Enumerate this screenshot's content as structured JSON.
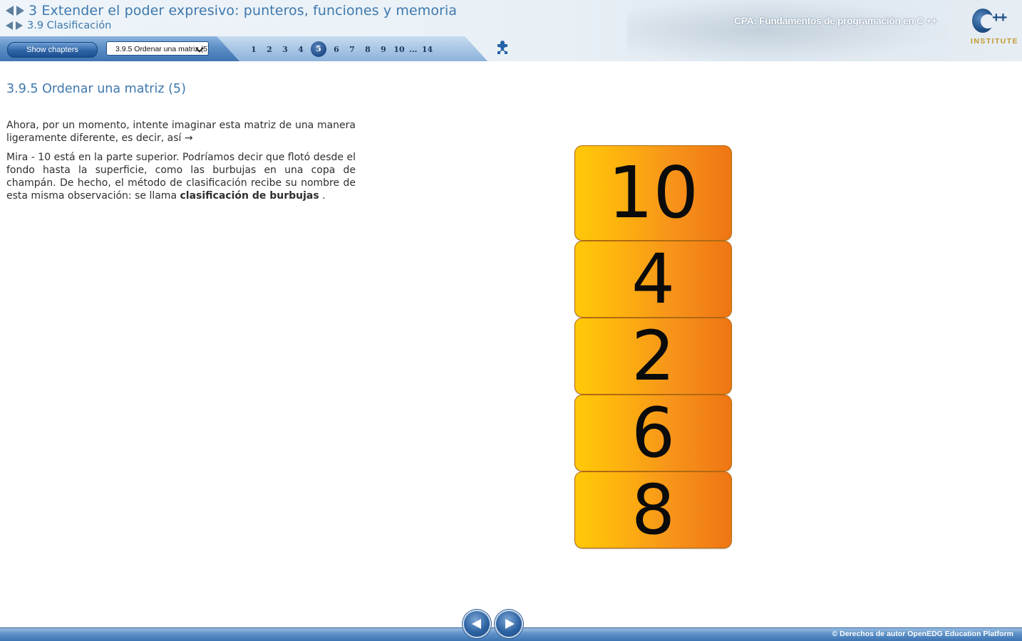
{
  "header": {
    "chapter_title": "3 Extender el poder expresivo: punteros, funciones y memoria",
    "section_title": "3.9 Clasificación",
    "course_title": "CPA: Fundamentos de programación en C ++",
    "logo_text": "INSTITUTE",
    "logo_plus": "++"
  },
  "toolbar": {
    "show_chapters_label": "Show chapters",
    "section_select_value": "3.9.5 Ordenar una matriz (5)",
    "pages": [
      "1",
      "2",
      "3",
      "4",
      "5",
      "6",
      "7",
      "8",
      "9",
      "10",
      "...",
      "14"
    ],
    "active_page": "5",
    "puzzle_icon": "puzzle-icon"
  },
  "content": {
    "page_title": "3.9.5 Ordenar una matriz (5)",
    "paragraph1": "Ahora, por un momento, intente imaginar esta matriz de una manera ligeramente diferente, es decir, así →",
    "paragraph2_text": "Mira - 10 está en la parte superior. Podríamos decir que flotó desde el fondo hasta la superficie, como las burbujas en una copa de champán. De hecho, el método de clasificación recibe su nombre de esta misma observación: se llama ",
    "paragraph2_bold": "clasificación de burbujas",
    "paragraph2_end": " .",
    "blocks": [
      "10",
      "4",
      "2",
      "6",
      "8"
    ]
  },
  "footer": {
    "copyright": "© Derechos de autor OpenEDG Education Platform",
    "prev_icon": "prev-arrow-icon",
    "next_icon": "next-arrow-icon"
  },
  "colors": {
    "accent_blue": "#3e78ad",
    "block_orange_left": "#ffc908",
    "block_orange_right": "#ef7514"
  }
}
